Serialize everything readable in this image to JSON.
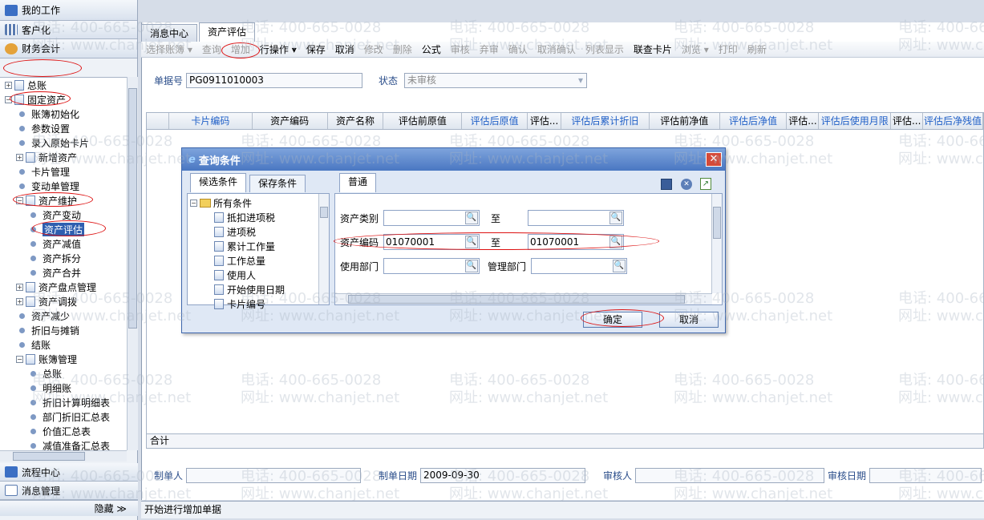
{
  "nav": {
    "my_work": "我的工作",
    "customize": "客户化",
    "finance": "财务会计",
    "process_center": "流程中心",
    "message_mgmt": "消息管理",
    "hide": "隐藏 ≫",
    "tree": [
      {
        "label": "总账",
        "type": "plus-doc",
        "indent": 0
      },
      {
        "label": "固定资产",
        "type": "minus-doc",
        "indent": 0
      },
      {
        "label": "账簿初始化",
        "type": "dot",
        "indent": 1
      },
      {
        "label": "参数设置",
        "type": "dot",
        "indent": 1
      },
      {
        "label": "录入原始卡片",
        "type": "dot",
        "indent": 1
      },
      {
        "label": "新增资产",
        "type": "plus-doc",
        "indent": 1
      },
      {
        "label": "卡片管理",
        "type": "dot",
        "indent": 1
      },
      {
        "label": "变动单管理",
        "type": "dot",
        "indent": 1
      },
      {
        "label": "资产维护",
        "type": "minus-doc",
        "indent": 1
      },
      {
        "label": "资产变动",
        "type": "dot",
        "indent": 2
      },
      {
        "label": "资产评估",
        "type": "dot",
        "indent": 2,
        "selected": true
      },
      {
        "label": "资产减值",
        "type": "dot",
        "indent": 2
      },
      {
        "label": "资产拆分",
        "type": "dot",
        "indent": 2
      },
      {
        "label": "资产合并",
        "type": "dot",
        "indent": 2
      },
      {
        "label": "资产盘点管理",
        "type": "plus-doc",
        "indent": 1
      },
      {
        "label": "资产调拨",
        "type": "plus-doc",
        "indent": 1
      },
      {
        "label": "资产减少",
        "type": "dot",
        "indent": 1
      },
      {
        "label": "折旧与摊销",
        "type": "dot",
        "indent": 1
      },
      {
        "label": "结账",
        "type": "dot",
        "indent": 1
      },
      {
        "label": "账簿管理",
        "type": "minus-doc",
        "indent": 1
      },
      {
        "label": "总账",
        "type": "dot",
        "indent": 2
      },
      {
        "label": "明细账",
        "type": "dot",
        "indent": 2
      },
      {
        "label": "折旧计算明细表",
        "type": "dot",
        "indent": 2
      },
      {
        "label": "部门折旧汇总表",
        "type": "dot",
        "indent": 2
      },
      {
        "label": "价值汇总表",
        "type": "dot",
        "indent": 2
      },
      {
        "label": "减值准备汇总表",
        "type": "dot",
        "indent": 2
      }
    ]
  },
  "tabs": [
    "消息中心",
    "资产评估"
  ],
  "toolbar": [
    {
      "label": "选择账簿 ▾",
      "enabled": false
    },
    {
      "label": "查询",
      "enabled": false
    },
    {
      "label": "增加",
      "enabled": false
    },
    {
      "label": "行操作 ▾",
      "enabled": true
    },
    {
      "label": "保存",
      "enabled": true
    },
    {
      "label": "取消",
      "enabled": true
    },
    {
      "label": "修改",
      "enabled": false
    },
    {
      "label": "删除",
      "enabled": false
    },
    {
      "label": "公式",
      "enabled": true
    },
    {
      "label": "审核",
      "enabled": false
    },
    {
      "label": "弃审",
      "enabled": false
    },
    {
      "label": "确认",
      "enabled": false
    },
    {
      "label": "取消确认",
      "enabled": false
    },
    {
      "label": "列表显示",
      "enabled": false
    },
    {
      "label": "联查卡片",
      "enabled": true
    },
    {
      "label": "浏览 ▾",
      "enabled": false
    },
    {
      "label": "打印",
      "enabled": false
    },
    {
      "label": "刷新",
      "enabled": false
    }
  ],
  "header": {
    "bill_no_label": "单据号",
    "bill_no_value": "PG0911010003",
    "status_label": "状态",
    "status_value": "未审核"
  },
  "grid": {
    "columns": [
      "卡片编码",
      "资产编码",
      "资产名称",
      "评估前原值",
      "评估后原值",
      "评估...",
      "评估后累计折旧",
      "评估前净值",
      "评估后净值",
      "评估...",
      "评估后使用月限",
      "评估...",
      "评估后净残值"
    ],
    "sum_label": "合计"
  },
  "footer": {
    "maker_label": "制单人",
    "make_date_label": "制单日期",
    "make_date_value": "2009-09-30",
    "reviewer_label": "审核人",
    "review_date_label": "审核日期"
  },
  "status_bar": "开始进行增加单据",
  "dialog": {
    "title": "查询条件",
    "tab_candidates": "候选条件",
    "tab_saved": "保存条件",
    "tab_normal": "普通",
    "conditions": [
      "所有条件",
      "抵扣进项税",
      "进项税",
      "累计工作量",
      "工作总量",
      "使用人",
      "开始使用日期",
      "卡片编号"
    ],
    "asset_category_label": "资产类别",
    "to_label": "至",
    "asset_code_label": "资产编码",
    "asset_code_from": "01070001",
    "asset_code_to": "01070001",
    "use_dept_label": "使用部门",
    "mgmt_dept_label": "管理部门",
    "ok": "确定",
    "cancel": "取消"
  },
  "watermark": {
    "phone": "电话: 400-665-0028",
    "site": "网址: www.chanjet.net"
  }
}
